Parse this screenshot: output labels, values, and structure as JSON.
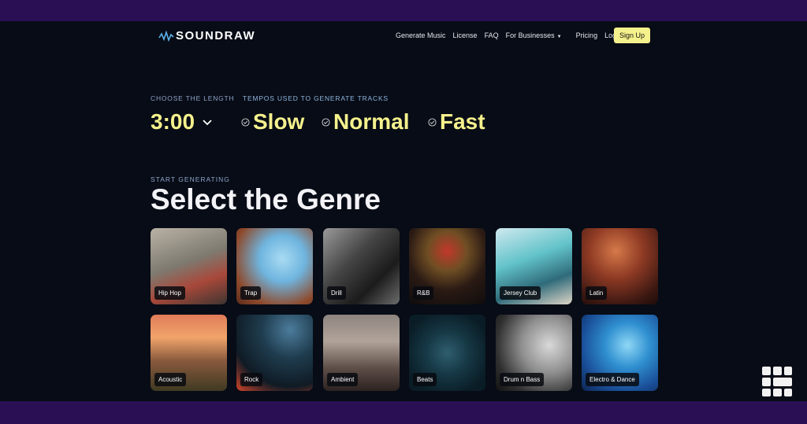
{
  "brand": {
    "name": "SOUNDRAW"
  },
  "nav": {
    "items": [
      "Generate Music",
      "License",
      "FAQ",
      "For Businesses",
      "Pricing",
      "Log In"
    ],
    "signup": "Sign Up"
  },
  "length": {
    "label": "CHOOSE THE LENGTH",
    "value": "3:00"
  },
  "tempo": {
    "label": "TEMPOS USED TO GENERATE TRACKS",
    "options": [
      "Slow",
      "Normal",
      "Fast"
    ]
  },
  "genre": {
    "kicker": "START GENERATING",
    "title": "Select the Genre",
    "items": [
      "Hip Hop",
      "Trap",
      "Drill",
      "R&B",
      "Jersey Club",
      "Latin",
      "Acoustic",
      "Rock",
      "Ambient",
      "Beats",
      "Drum n Bass",
      "Electro & Dance"
    ]
  },
  "colors": {
    "accent": "#f5f18c",
    "background": "#070c16",
    "frame": "#2a0f55"
  }
}
